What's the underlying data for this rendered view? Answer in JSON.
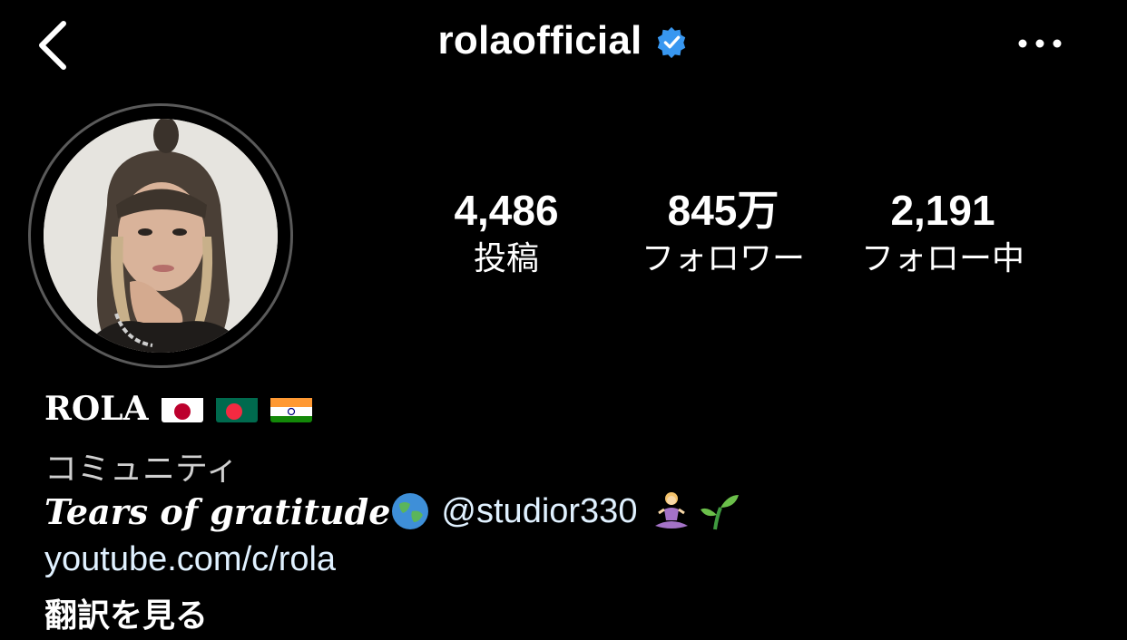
{
  "header": {
    "username": "rolaofficial",
    "verified": true,
    "accent_verified": "#3897f0"
  },
  "stats": [
    {
      "value": "4,486",
      "label": "投稿"
    },
    {
      "value": "845万",
      "label": "フォロワー"
    },
    {
      "value": "2,191",
      "label": "フォロー中"
    }
  ],
  "bio": {
    "display_name": "ROLA",
    "flags": [
      "japan-flag",
      "bangladesh-flag",
      "india-flag"
    ],
    "category": "コミュニティ",
    "text": "Tears of gratitude",
    "mention": "@studior330",
    "emojis": [
      "globe-emoji",
      "meditation-emoji",
      "seedling-emoji"
    ],
    "link": "youtube.com/c/rola",
    "translate_label": "翻訳を見る"
  },
  "colors": {
    "background": "#000000",
    "text": "#ffffff",
    "link": "#e0f1ff"
  }
}
